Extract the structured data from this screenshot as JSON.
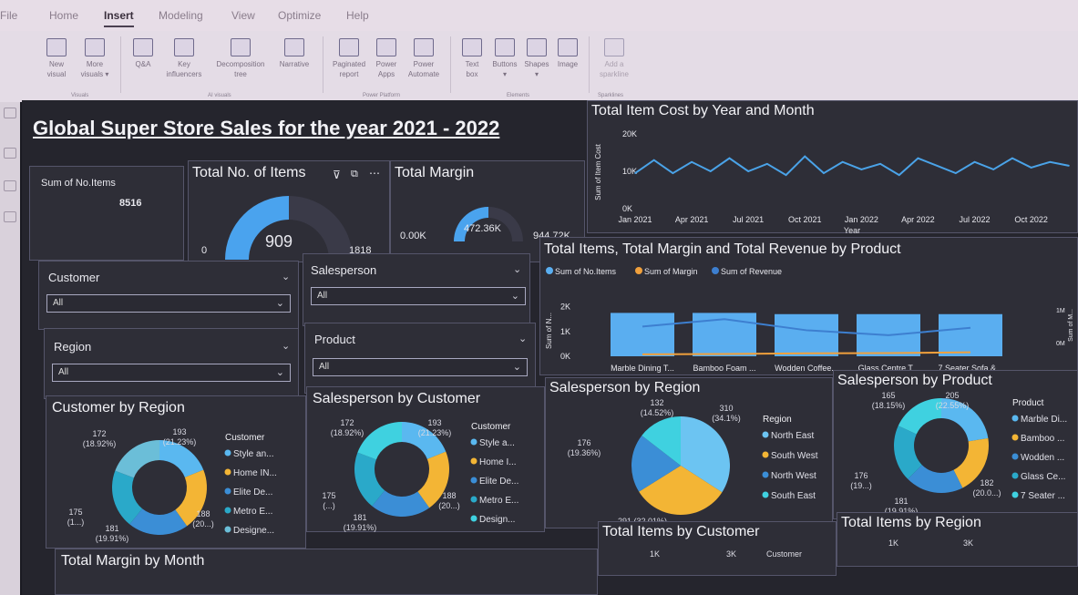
{
  "ribbon": {
    "tabs": [
      "File",
      "Home",
      "Insert",
      "Modeling",
      "View",
      "Optimize",
      "Help"
    ],
    "buttons": [
      {
        "l1": "New",
        "l2": "visual"
      },
      {
        "l1": "More",
        "l2": "visuals ▾"
      },
      {
        "l1": "Q&A",
        "l2": ""
      },
      {
        "l1": "Key",
        "l2": "influencers"
      },
      {
        "l1": "Decomposition",
        "l2": "tree"
      },
      {
        "l1": "Narrative",
        "l2": ""
      },
      {
        "l1": "Paginated",
        "l2": "report"
      },
      {
        "l1": "Power",
        "l2": "Apps"
      },
      {
        "l1": "Power",
        "l2": "Automate"
      },
      {
        "l1": "Text",
        "l2": "box"
      },
      {
        "l1": "Buttons",
        "l2": "▾"
      },
      {
        "l1": "Shapes",
        "l2": "▾"
      },
      {
        "l1": "Image",
        "l2": ""
      },
      {
        "l1": "Add a",
        "l2": "sparkline"
      }
    ],
    "groups": [
      "Visuals",
      "AI visuals",
      "Power Platform",
      "Elements",
      "Sparklines"
    ]
  },
  "dashboard": {
    "title": "Global Super Store Sales for the year 2021 - 2022",
    "sum_items_label": "Sum of No.Items",
    "sum_items_value": "8516",
    "gauge_items": {
      "title": "Total No. of Items",
      "value": "909",
      "min": "0",
      "max": "1818",
      "fraction": 0.5
    },
    "gauge_margin": {
      "title": "Total Margin",
      "value": "472.36K",
      "min": "0.00K",
      "max": "944.72K",
      "fraction": 0.5
    },
    "slicers": [
      {
        "label": "Customer",
        "value": "All"
      },
      {
        "label": "Salesperson",
        "value": "All"
      },
      {
        "label": "Region",
        "value": "All"
      },
      {
        "label": "Product",
        "value": "All"
      }
    ],
    "bottom_titles": [
      "Total Items by Customer",
      "Total Items by Region",
      "Total Margin by Month"
    ],
    "bottom_ticks": [
      "1K",
      "3K",
      "Customer",
      "1K",
      "3K"
    ]
  },
  "chart_data": [
    {
      "type": "line",
      "title": "Total Item Cost by Year and Month",
      "xlabel": "Year",
      "ylabel": "Sum of Item Cost",
      "ytick_labels": [
        "0K",
        "10K",
        "20K"
      ],
      "xtick_labels": [
        "Jan 2021",
        "Apr 2021",
        "Jul 2021",
        "Oct 2021",
        "Jan 2022",
        "Apr 2022",
        "Jul 2022",
        "Oct 2022"
      ],
      "ylim": [
        0,
        20000
      ],
      "x": [
        "Jan 2021",
        "Feb 2021",
        "Mar 2021",
        "Apr 2021",
        "May 2021",
        "Jun 2021",
        "Jul 2021",
        "Aug 2021",
        "Sep 2021",
        "Oct 2021",
        "Nov 2021",
        "Dec 2021",
        "Jan 2022",
        "Feb 2022",
        "Mar 2022",
        "Apr 2022",
        "May 2022",
        "Jun 2022",
        "Jul 2022",
        "Aug 2022",
        "Sep 2022",
        "Oct 2022",
        "Nov 2022",
        "Dec 2022"
      ],
      "values": [
        9500,
        13000,
        9500,
        12500,
        10000,
        13500,
        10000,
        12000,
        9000,
        14000,
        9500,
        12500,
        10500,
        12000,
        9000,
        13500,
        11500,
        9500,
        12500,
        10500,
        13500,
        11000,
        12500,
        11500
      ],
      "color": "#4aa3e8"
    },
    {
      "type": "bar",
      "title": "Total Items, Total Margin and Total Revenue by Product",
      "categories": [
        "Marble Dining T...",
        "Bamboo Foam ...",
        "Wodden Coffee...",
        "Glass Centre T...",
        "7 Seater Sofa &..."
      ],
      "ylabel": "Sum of N...",
      "y2label": "Sum of M...",
      "ytick_labels": [
        "0K",
        "1K",
        "2K"
      ],
      "y2tick_labels": [
        "0M",
        "1M"
      ],
      "ylim": [
        0,
        2500
      ],
      "series": [
        {
          "name": "Sum of No.Items",
          "kind": "bar",
          "values": [
            1750,
            1750,
            1700,
            1700,
            1700
          ],
          "color": "#5aaef0"
        },
        {
          "name": "Sum of Margin",
          "kind": "line",
          "values": [
            80,
            90,
            120,
            130,
            160
          ],
          "color": "#f0a03c"
        },
        {
          "name": "Sum of Revenue",
          "kind": "line",
          "values": [
            1200,
            1500,
            1050,
            850,
            1150
          ],
          "color": "#3d7fd0"
        }
      ]
    },
    {
      "type": "pie",
      "title": "Customer by Region",
      "donut": true,
      "legend_title": "Customer",
      "slices": [
        {
          "label": "Style an...",
          "value": 172,
          "display": "172\n(18.92%)",
          "color": "#5ab8f0"
        },
        {
          "label": "Home IN...",
          "value": 193,
          "display": "193\n(21.23%)",
          "color": "#f3b535"
        },
        {
          "label": "Elite De...",
          "value": 188,
          "display": "188\n(20...)",
          "color": "#3b8ed6"
        },
        {
          "label": "Metro E...",
          "value": 181,
          "display": "181\n(19.91%)",
          "color": "#2aa9c9"
        },
        {
          "label": "Designe...",
          "value": 175,
          "display": "175\n(1...)",
          "color": "#6bbed8"
        }
      ]
    },
    {
      "type": "pie",
      "title": "Salesperson by Customer",
      "donut": true,
      "legend_title": "Customer",
      "slices": [
        {
          "label": "Style a...",
          "value": 172,
          "display": "172\n(18.92%)",
          "color": "#5ab8f0"
        },
        {
          "label": "Home I...",
          "value": 193,
          "display": "193\n(21.23%)",
          "color": "#f3b535"
        },
        {
          "label": "Elite De...",
          "value": 188,
          "display": "188\n(20...)",
          "color": "#3b8ed6"
        },
        {
          "label": "Metro E...",
          "value": 181,
          "display": "181\n(19.91%)",
          "color": "#2aa9c9"
        },
        {
          "label": "Design...",
          "value": 175,
          "display": "175\n(...)",
          "color": "#3fd1e0"
        }
      ]
    },
    {
      "type": "pie",
      "title": "Salesperson by Region",
      "donut": false,
      "legend_title": "Region",
      "slices": [
        {
          "label": "North East",
          "value": 310,
          "display": "310\n(34.1%)",
          "color": "#6cc4f2"
        },
        {
          "label": "South West",
          "value": 291,
          "display": "291 (32.01%)",
          "color": "#f3b535"
        },
        {
          "label": "North West",
          "value": 176,
          "display": "176\n(19.36%)",
          "color": "#3b8ed6"
        },
        {
          "label": "South East",
          "value": 132,
          "display": "132\n(14.52%)",
          "color": "#3fd1e0"
        }
      ]
    },
    {
      "type": "pie",
      "title": "Salesperson by Product",
      "donut": true,
      "legend_title": "Product",
      "slices": [
        {
          "label": "Marble Di...",
          "value": 205,
          "display": "205\n(22.55%)",
          "color": "#5ab8f0"
        },
        {
          "label": "Bamboo ...",
          "value": 182,
          "display": "182\n(20.0...)",
          "color": "#f3b535"
        },
        {
          "label": "Wodden ...",
          "value": 181,
          "display": "181\n(19.91%)",
          "color": "#3b8ed6"
        },
        {
          "label": "Glass Ce...",
          "value": 176,
          "display": "176\n(19...)",
          "color": "#2aa9c9"
        },
        {
          "label": "7 Seater ...",
          "value": 165,
          "display": "165\n(18.15%)",
          "color": "#3fd1e0"
        }
      ]
    }
  ]
}
